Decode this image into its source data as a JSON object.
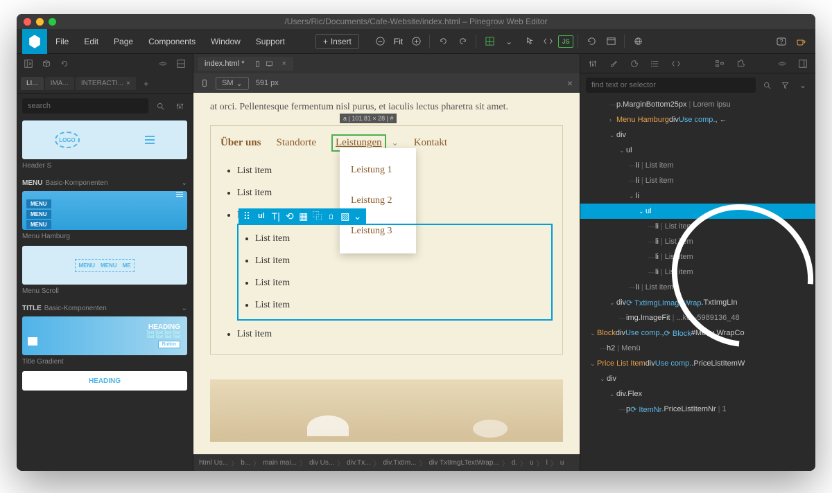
{
  "titlebar": {
    "path": "/Users/Ric/Documents/Cafe-Website/index.html – Pinegrow Web Editor"
  },
  "menubar": [
    "File",
    "Edit",
    "Page",
    "Components",
    "Window",
    "Support"
  ],
  "toolbar": {
    "insert": "Insert",
    "fit": "Fit"
  },
  "left": {
    "tabs": [
      {
        "label": "LI..."
      },
      {
        "label": "IMA..."
      },
      {
        "label": "INTERACTI..."
      }
    ],
    "search_placeholder": "search",
    "thumbs": {
      "header_s": "Header S",
      "menu_section": "MENU",
      "menu_section_sub": "Basic-Komponenten",
      "menu_hamburg": "Menu Hamburg",
      "menu_scroll": "Menu Scroll",
      "title_section": "TITLE",
      "title_section_sub": "Basic-Komponenten",
      "title_gradient": "Title Gradient",
      "logo_text": "LOGO",
      "menu_bar_text": "MENU",
      "heading_text": "HEADING",
      "button_text": "Button"
    }
  },
  "center": {
    "tab": "index.html *",
    "viewport_label": "SM",
    "viewport_width": "591 px",
    "page_text": "at orci. Pellentesque fermentum nisl purus, et iaculis lectus pharetra sit amet.",
    "nav": [
      "Über uns",
      "Standorte",
      "Leistungen",
      "Kontakt"
    ],
    "selection_badge": "a | 101.81 × 28 | #",
    "dropdown": [
      "Leistung 1",
      "Leistung 2",
      "Leistung 3"
    ],
    "list_item": "List item",
    "ul_label": "ul",
    "breadcrumb": [
      "html Us...",
      "b...",
      "main mai...",
      "div Us...",
      "div.Tx...",
      "div.TxtIm...",
      "div TxtImgLTextWrap...",
      "d.",
      "u",
      "l",
      "u"
    ]
  },
  "right": {
    "search_placeholder": "find text or selector",
    "tree": [
      {
        "indent": 2,
        "chev": "",
        "parts": [
          {
            "t": "tag",
            "v": "p.MarginBottom25px"
          },
          {
            "t": "sep",
            "v": "|"
          },
          {
            "t": "text",
            "v": "Lorem ipsu"
          }
        ]
      },
      {
        "indent": 2,
        "chev": "›",
        "parts": [
          {
            "t": "orange",
            "v": "Menu Hamburg"
          },
          {
            "t": "tag",
            "v": " div "
          },
          {
            "t": "blue",
            "v": "Use comp."
          },
          {
            "t": "tag",
            "v": ", ←"
          }
        ]
      },
      {
        "indent": 2,
        "chev": "v",
        "parts": [
          {
            "t": "tag",
            "v": "div"
          }
        ]
      },
      {
        "indent": 3,
        "chev": "v",
        "parts": [
          {
            "t": "tag",
            "v": "ul"
          }
        ]
      },
      {
        "indent": 4,
        "chev": "",
        "parts": [
          {
            "t": "tag",
            "v": "li"
          },
          {
            "t": "sep",
            "v": "|"
          },
          {
            "t": "text",
            "v": "List item"
          }
        ]
      },
      {
        "indent": 4,
        "chev": "",
        "parts": [
          {
            "t": "tag",
            "v": "li"
          },
          {
            "t": "sep",
            "v": "|"
          },
          {
            "t": "text",
            "v": "List item"
          }
        ]
      },
      {
        "indent": 4,
        "chev": "v",
        "parts": [
          {
            "t": "tag",
            "v": "li"
          }
        ]
      },
      {
        "indent": 5,
        "chev": "v",
        "parts": [
          {
            "t": "tag",
            "v": "ul"
          }
        ],
        "selected": true
      },
      {
        "indent": 6,
        "chev": "",
        "parts": [
          {
            "t": "tag",
            "v": "li"
          },
          {
            "t": "sep",
            "v": "|"
          },
          {
            "t": "text",
            "v": "List item"
          }
        ]
      },
      {
        "indent": 6,
        "chev": "",
        "parts": [
          {
            "t": "tag",
            "v": "li"
          },
          {
            "t": "sep",
            "v": "|"
          },
          {
            "t": "text",
            "v": "List item"
          }
        ]
      },
      {
        "indent": 6,
        "chev": "",
        "parts": [
          {
            "t": "tag",
            "v": "li"
          },
          {
            "t": "sep",
            "v": "|"
          },
          {
            "t": "text",
            "v": "List item"
          }
        ]
      },
      {
        "indent": 6,
        "chev": "",
        "parts": [
          {
            "t": "tag",
            "v": "li"
          },
          {
            "t": "sep",
            "v": "|"
          },
          {
            "t": "text",
            "v": "List item"
          }
        ]
      },
      {
        "indent": 4,
        "chev": "",
        "parts": [
          {
            "t": "tag",
            "v": "li"
          },
          {
            "t": "sep",
            "v": "|"
          },
          {
            "t": "text",
            "v": "List item"
          }
        ]
      },
      {
        "indent": 2,
        "chev": "v",
        "parts": [
          {
            "t": "tag",
            "v": "div "
          },
          {
            "t": "blue",
            "v": "⟳ TxtImgLImageWrap"
          },
          {
            "t": "tag",
            "v": " .TxtImgLIn"
          }
        ]
      },
      {
        "indent": 3,
        "chev": "",
        "parts": [
          {
            "t": "tag",
            "v": "img.ImageFit"
          },
          {
            "t": "sep",
            "v": "|"
          },
          {
            "t": "text",
            "v": "...kes-5989136_48"
          }
        ]
      },
      {
        "indent": 0,
        "chev": "v",
        "parts": [
          {
            "t": "orange",
            "v": "Block"
          },
          {
            "t": "tag",
            "v": " div "
          },
          {
            "t": "blue",
            "v": "Use comp."
          },
          {
            "t": "tag",
            "v": ", "
          },
          {
            "t": "blue",
            "v": "⟳ Block"
          },
          {
            "t": "tag",
            "v": " #Menu.WrapCo"
          }
        ]
      },
      {
        "indent": 1,
        "chev": "",
        "parts": [
          {
            "t": "tag",
            "v": "h2"
          },
          {
            "t": "sep",
            "v": "|"
          },
          {
            "t": "text",
            "v": "Menü"
          }
        ]
      },
      {
        "indent": 0,
        "chev": "v",
        "parts": [
          {
            "t": "orange",
            "v": "Price List Item"
          },
          {
            "t": "tag",
            "v": " div "
          },
          {
            "t": "blue",
            "v": "Use comp."
          },
          {
            "t": "tag",
            "v": " .PriceListItemW"
          }
        ]
      },
      {
        "indent": 1,
        "chev": "v",
        "parts": [
          {
            "t": "tag",
            "v": "div"
          }
        ]
      },
      {
        "indent": 2,
        "chev": "v",
        "parts": [
          {
            "t": "tag",
            "v": "div.Flex"
          }
        ]
      },
      {
        "indent": 3,
        "chev": "",
        "parts": [
          {
            "t": "tag",
            "v": "p "
          },
          {
            "t": "blue",
            "v": "⟳ ItemNr"
          },
          {
            "t": "tag",
            "v": " .PriceListItemNr"
          },
          {
            "t": "sep",
            "v": "|"
          },
          {
            "t": "text",
            "v": "1"
          }
        ]
      }
    ]
  }
}
